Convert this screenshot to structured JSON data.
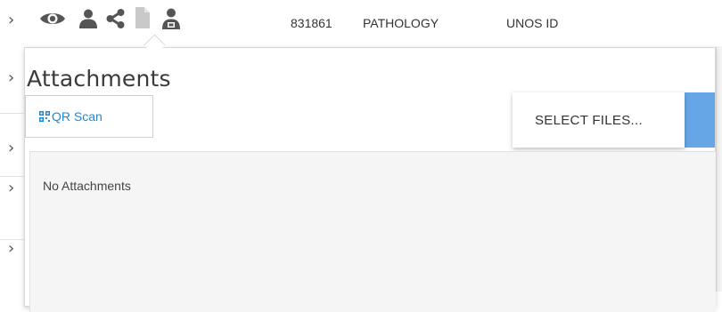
{
  "toolbar": {
    "icons": [
      "eye-icon",
      "user-icon",
      "share-icon",
      "document-icon",
      "user-tag-icon"
    ],
    "record_number": "831861",
    "department": "PATHOLOGY",
    "unos_label": "UNOS ID"
  },
  "attachments": {
    "title": "Attachments",
    "qr_scan_label": "QR Scan",
    "select_files_label": "SELECT FILES...",
    "empty_message": "No Attachments"
  },
  "colors": {
    "accent_blue": "#1e88d6",
    "upload_strip_blue": "#66a6e6",
    "icon_gray": "#555555",
    "area_bg": "#f5f5f5"
  }
}
